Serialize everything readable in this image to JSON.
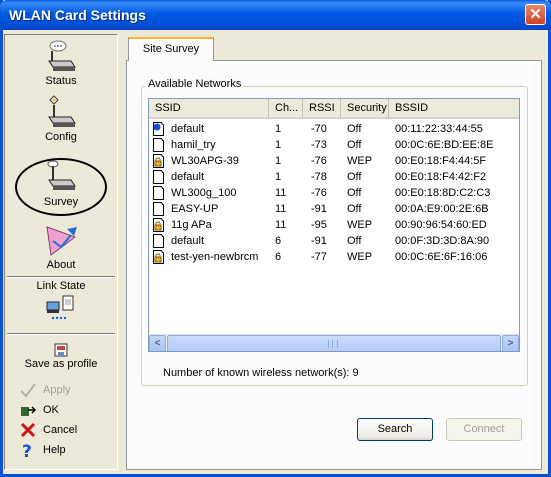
{
  "window": {
    "title": "WLAN Card Settings",
    "close_glyph": "✕"
  },
  "sidebar": {
    "nav": [
      {
        "label": "Status",
        "icon": "status-icon"
      },
      {
        "label": "Config",
        "icon": "config-icon"
      },
      {
        "label": "Survey",
        "icon": "survey-icon"
      },
      {
        "label": "About",
        "icon": "about-icon"
      }
    ],
    "link_state_label": "Link State",
    "actions": {
      "save_profile": "Save as profile",
      "apply": "Apply",
      "ok": "OK",
      "cancel": "Cancel",
      "help": "Help"
    }
  },
  "tab": {
    "label": "Site Survey"
  },
  "networks": {
    "group_title": "Available Networks",
    "columns": [
      "SSID",
      "Ch...",
      "RSSI",
      "Security",
      "BSSID"
    ],
    "rows": [
      {
        "ssid": "default",
        "ch": "1",
        "rssi": "-70",
        "security": "Off",
        "bssid": "00:11:22:33:44:55",
        "icon": "connected-network-icon"
      },
      {
        "ssid": "hamil_try",
        "ch": "1",
        "rssi": "-73",
        "security": "Off",
        "bssid": "00:0C:6E:BD:EE:8E",
        "icon": "open-network-icon"
      },
      {
        "ssid": "WL30APG-39",
        "ch": "1",
        "rssi": "-76",
        "security": "WEP",
        "bssid": "00:E0:18:F4:44:5F",
        "icon": "secured-network-icon"
      },
      {
        "ssid": "default",
        "ch": "1",
        "rssi": "-78",
        "security": "Off",
        "bssid": "00:E0:18:F4:42:F2",
        "icon": "open-network-icon"
      },
      {
        "ssid": "WL300g_100",
        "ch": "11",
        "rssi": "-76",
        "security": "Off",
        "bssid": "00:E0:18:8D:C2:C3",
        "icon": "open-network-icon"
      },
      {
        "ssid": "EASY-UP",
        "ch": "11",
        "rssi": "-91",
        "security": "Off",
        "bssid": "00:0A:E9:00:2E:6B",
        "icon": "open-network-icon"
      },
      {
        "ssid": "11g APa",
        "ch": "11",
        "rssi": "-95",
        "security": "WEP",
        "bssid": "00:90:96:54:60:ED",
        "icon": "secured-network-icon"
      },
      {
        "ssid": "default",
        "ch": "6",
        "rssi": "-91",
        "security": "Off",
        "bssid": "00:0F:3D:3D:8A:90",
        "icon": "open-network-icon"
      },
      {
        "ssid": "test-yen-newbrcm",
        "ch": "6",
        "rssi": "-77",
        "security": "WEP",
        "bssid": "00:0C:6E:6F:16:06",
        "icon": "secured-network-icon"
      }
    ],
    "count_label": "Number of known wireless network(s): 9"
  },
  "buttons": {
    "search": "Search",
    "connect": "Connect"
  }
}
